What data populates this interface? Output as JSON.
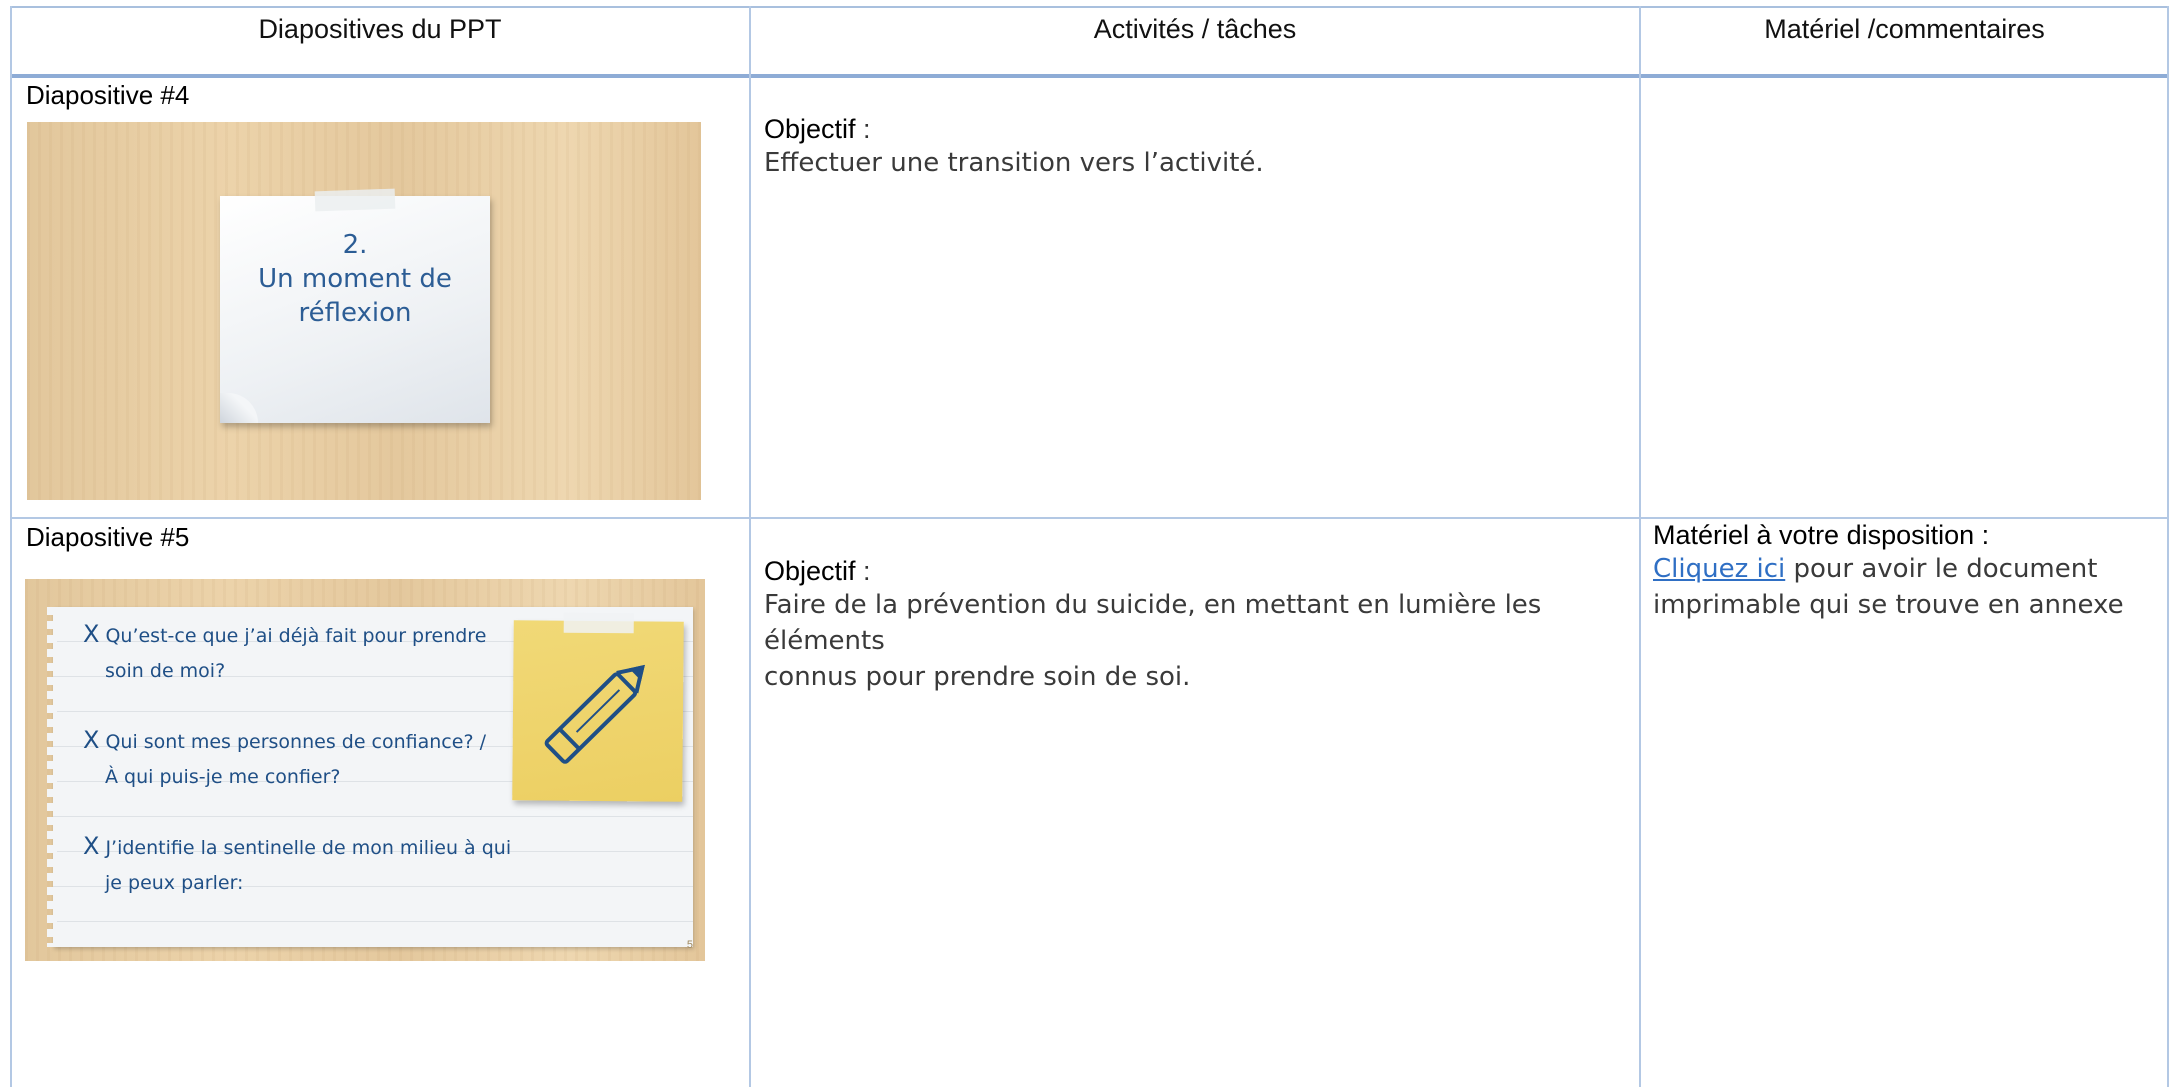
{
  "table": {
    "headers": [
      "Diapositives du PPT",
      "Activités / tâches",
      "Matériel /commentaires"
    ]
  },
  "rows": [
    {
      "slide_label": "Diapositive #4",
      "slide_text": [
        "2.",
        "Un moment de",
        "réflexion"
      ],
      "objective_title": "Objectif",
      "objective_colon": " :",
      "objective_text": "Effectuer une transition vers l’activité."
    },
    {
      "slide_label": "Diapositive #5",
      "slide_items": [
        [
          "Qu’est-ce que j’ai déjà fait pour prendre",
          "soin de moi?"
        ],
        [
          "Qui sont mes personnes de confiance? /",
          "À qui puis-je me confier?"
        ],
        [
          "J’identifie la sentinelle de mon milieu à qui",
          "je peux parler:"
        ]
      ],
      "slide_mark": "X",
      "slide_page": "5",
      "objective_title": "Objectif",
      "objective_colon": " :",
      "objective_text_1": "Faire de la prévention du suicide, en mettant en lumière les éléments",
      "objective_text_2": "connus pour prendre soin de soi.",
      "material_title": "Matériel à votre disposition :",
      "material_link": "Cliquez ici",
      "material_text_1": " pour avoir le document",
      "material_text_2": "imprimable qui se trouve en annexe"
    }
  ],
  "colors": {
    "border": "#b3c8e4",
    "header_border": "#8eacd6",
    "link": "#2f6fc4",
    "slide_text": "#2c5d95",
    "sticky": "#eccf62"
  },
  "icons": [
    "pencil-icon",
    "check-x-icon"
  ]
}
